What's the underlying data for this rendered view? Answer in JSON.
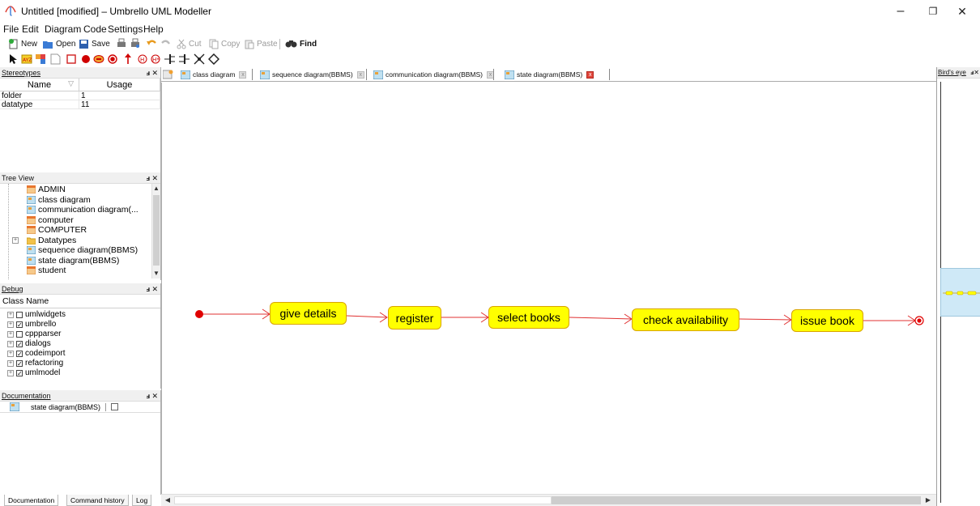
{
  "window": {
    "title": "Untitled [modified] – Umbrello UML Modeller",
    "controls": [
      "–",
      "❐",
      "✕"
    ]
  },
  "menu": [
    "File",
    "Edit",
    "Diagram",
    "Code",
    "Settings",
    "Help"
  ],
  "toolbar": {
    "new": "New",
    "open": "Open",
    "save": "Save",
    "cut": "Cut",
    "copy": "Copy",
    "paste": "Paste",
    "find": "Find"
  },
  "stereotypes": {
    "title": "Stereotypes",
    "columns": [
      "Name",
      "Usage"
    ],
    "rows": [
      {
        "name": "folder",
        "usage": "1"
      },
      {
        "name": "datatype",
        "usage": "11"
      }
    ]
  },
  "treeview": {
    "title": "Tree View",
    "items": [
      {
        "label": "ADMIN",
        "icon": "class"
      },
      {
        "label": "class diagram",
        "icon": "diagram"
      },
      {
        "label": "communication diagram(...",
        "icon": "diagram"
      },
      {
        "label": "computer",
        "icon": "class"
      },
      {
        "label": "COMPUTER",
        "icon": "class"
      },
      {
        "label": "Datatypes",
        "icon": "folder"
      },
      {
        "label": "sequence diagram(BBMS)",
        "icon": "diagram"
      },
      {
        "label": "state diagram(BBMS)",
        "icon": "diagram"
      },
      {
        "label": "student",
        "icon": "class"
      }
    ]
  },
  "debug": {
    "title": "Debug",
    "column": "Class Name",
    "items": [
      {
        "label": "umlwidgets",
        "checked": false
      },
      {
        "label": "umbrello",
        "checked": true
      },
      {
        "label": "cppparser",
        "checked": false
      },
      {
        "label": "dialogs",
        "checked": true
      },
      {
        "label": "codeimport",
        "checked": true
      },
      {
        "label": "refactoring",
        "checked": true
      },
      {
        "label": "umlmodel",
        "checked": true
      }
    ]
  },
  "documentation": {
    "title": "Documentation",
    "diagram_name": "state diagram(BBMS)"
  },
  "bottom_tabs": [
    "Documentation",
    "Command history",
    "Log"
  ],
  "tabs": [
    {
      "label": "class diagram",
      "active": false
    },
    {
      "label": "sequence diagram(BBMS)",
      "active": false
    },
    {
      "label": "communication diagram(BBMS)",
      "active": false
    },
    {
      "label": "state diagram(BBMS)",
      "active": true
    }
  ],
  "birdseye": {
    "title": "Bird's eye"
  },
  "diagram": {
    "states": [
      "give details",
      "register",
      "select books",
      "check availability",
      "issue book"
    ]
  },
  "colors": {
    "state_fill": "#ffff00",
    "state_border": "#d9a400",
    "transition": "#e03030",
    "initial": "#e00000",
    "birdseye_view": "#cfe9f7"
  }
}
